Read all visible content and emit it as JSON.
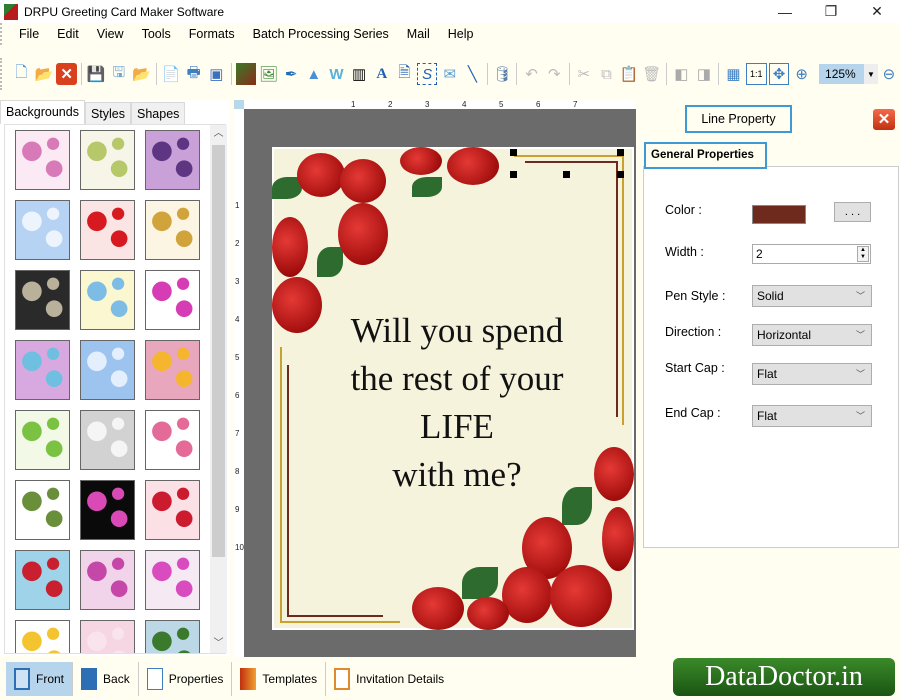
{
  "window": {
    "title": "DRPU Greeting Card Maker Software",
    "controls": {
      "minimize": "—",
      "restore": "❐",
      "close": "✕"
    }
  },
  "menu": [
    "File",
    "Edit",
    "View",
    "Tools",
    "Formats",
    "Batch Processing Series",
    "Mail",
    "Help"
  ],
  "toolbar": {
    "icons": [
      "new-icon",
      "open-icon",
      "close-icon",
      "save-icon",
      "save-as-icon",
      "export-icon",
      "properties-icon",
      "print-icon",
      "print-preview-icon",
      "background-icon",
      "image-icon",
      "pen-icon",
      "shapes-icon",
      "watermark-icon",
      "barcode-icon",
      "text-icon",
      "word-art-icon",
      "signature-icon",
      "mail-icon",
      "line-icon",
      "database-icon",
      "undo-icon",
      "redo-icon",
      "cut-icon",
      "copy-icon",
      "paste-icon",
      "delete-icon",
      "bring-front-icon",
      "send-back-icon",
      "grid-icon",
      "actual-size-icon",
      "fit-icon",
      "zoom-in-icon",
      "zoom-out-icon"
    ],
    "zoom_value": "125%"
  },
  "left_panel": {
    "tabs": [
      "Backgrounds",
      "Styles",
      "Shapes"
    ],
    "active_tab": "Backgrounds",
    "thumbnails": [
      {
        "name": "baby-pink",
        "c1": "#fbe9f3",
        "c2": "#d87ab8"
      },
      {
        "name": "baby-pastel",
        "c1": "#f7f4e8",
        "c2": "#b7c86a"
      },
      {
        "name": "purple-floral",
        "c1": "#c9a1d8",
        "c2": "#5e3583"
      },
      {
        "name": "clouds",
        "c1": "#b7d3f3",
        "c2": "#eef4fd"
      },
      {
        "name": "strawberries",
        "c1": "#fbe4e4",
        "c2": "#d71920"
      },
      {
        "name": "autumn-leaves",
        "c1": "#fdf5e4",
        "c2": "#d1a43b"
      },
      {
        "name": "dark-bokeh",
        "c1": "#2a2a2a",
        "c2": "#b9b19a"
      },
      {
        "name": "cream-hearts",
        "c1": "#fbf7d0",
        "c2": "#7dbce4"
      },
      {
        "name": "gift-boxes",
        "c1": "#ffffff",
        "c2": "#d63db4"
      },
      {
        "name": "pastel-flowers",
        "c1": "#d7a9e0",
        "c2": "#6fbfe0"
      },
      {
        "name": "snowflakes",
        "c1": "#9cc4ee",
        "c2": "#e3effd"
      },
      {
        "name": "flower-circles",
        "c1": "#e8a7bd",
        "c2": "#f5b52e"
      },
      {
        "name": "green-trees",
        "c1": "#f2f9e6",
        "c2": "#7cc242"
      },
      {
        "name": "white-heart",
        "c1": "#d2d2d2",
        "c2": "#f5f5f5"
      },
      {
        "name": "kids-doodles",
        "c1": "#ffffff",
        "c2": "#e46b97"
      },
      {
        "name": "hanging-ornaments",
        "c1": "#ffffff",
        "c2": "#6a8f3a"
      },
      {
        "name": "fireworks",
        "c1": "#0a0a0a",
        "c2": "#d94ab6"
      },
      {
        "name": "red-hearts",
        "c1": "#fbe0e6",
        "c2": "#cc1a2f"
      },
      {
        "name": "christmas",
        "c1": "#9ed3e9",
        "c2": "#c8202f"
      },
      {
        "name": "pink-bokeh",
        "c1": "#f1d3ea",
        "c2": "#c548a9"
      },
      {
        "name": "pink-lilies",
        "c1": "#f5e9f3",
        "c2": "#d94cbf"
      },
      {
        "name": "colorful-stars",
        "c1": "#ffffff",
        "c2": "#f4c430"
      },
      {
        "name": "plain-pink",
        "c1": "#f6d6e2",
        "c2": "#f9e3ec"
      },
      {
        "name": "snowmen",
        "c1": "#bcd8e6",
        "c2": "#3b7a2d"
      }
    ]
  },
  "canvas": {
    "ruler_h": [
      "1",
      "2",
      "3",
      "4",
      "5",
      "6",
      "7"
    ],
    "ruler_v": [
      "1",
      "2",
      "3",
      "4",
      "5",
      "6",
      "7",
      "8",
      "9",
      "10"
    ],
    "card_lines": [
      "Will you spend",
      "the rest of your",
      "LIFE",
      "with me?"
    ]
  },
  "properties": {
    "title": "Line Property",
    "section_tab": "General Properties",
    "color_label": "Color :",
    "color_value": "#6e2a1d",
    "color_button": ". . .",
    "width_label": "Width :",
    "width_value": "2",
    "pen_style_label": "Pen Style :",
    "pen_style_value": "Solid",
    "direction_label": "Direction :",
    "direction_value": "Horizontal",
    "start_cap_label": "Start Cap :",
    "start_cap_value": "Flat",
    "end_cap_label": "End Cap :",
    "end_cap_value": "Flat"
  },
  "bottom_bar": {
    "items": [
      {
        "label": "Front",
        "icon": "front-page-icon",
        "active": true
      },
      {
        "label": "Back",
        "icon": "back-page-icon",
        "active": false
      },
      {
        "label": "Properties",
        "icon": "properties-icon",
        "active": false
      },
      {
        "label": "Templates",
        "icon": "templates-icon",
        "active": false
      },
      {
        "label": "Invitation Details",
        "icon": "invitation-details-icon",
        "active": false
      }
    ]
  },
  "watermark": "DataDoctor.in"
}
